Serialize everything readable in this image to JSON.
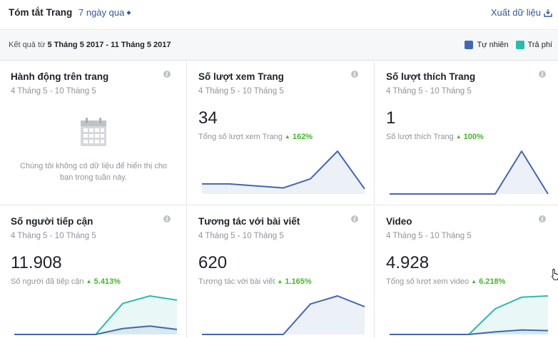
{
  "header": {
    "title": "Tóm tắt Trang",
    "range": "7 ngày qua",
    "export": "Xuất dữ liệu"
  },
  "result_bar": {
    "prefix": "Kết quả từ",
    "range": "5 Tháng 5 2017 - 11 Tháng 5 2017"
  },
  "legend": [
    {
      "label": "Tự nhiên",
      "color": "#4267b2"
    },
    {
      "label": "Trả phí",
      "color": "#2bbbad"
    }
  ],
  "colors": {
    "organic": "#4267b2",
    "paid": "#2bbbad",
    "link": "#365899",
    "up": "#42b72a"
  },
  "cards": [
    {
      "title": "Hành động trên trang",
      "date": "4 Tháng 5 - 10 Tháng 5",
      "no_data": "Chúng tôi không có dữ liệu để hiển thị cho bạn trong tuần này.",
      "icon": "calendar-icon"
    },
    {
      "title": "Số lượt xem Trang",
      "date": "4 Tháng 5 - 10 Tháng 5",
      "value": "34",
      "sub": "Tổng số lượt xem Trang",
      "change": "162%"
    },
    {
      "title": "Số lượt thích Trang",
      "date": "4 Tháng 5 - 10 Tháng 5",
      "value": "1",
      "sub": "Số lượt thích Trang",
      "change": "100%"
    },
    {
      "title": "Số người tiếp cận",
      "date": "4 Tháng 5 - 10 Tháng 5",
      "value": "11.908",
      "sub": "Số người đã tiếp cận",
      "change": "5.413%"
    },
    {
      "title": "Tương tác với bài viết",
      "date": "4 Tháng 5 - 10 Tháng 5",
      "value": "620",
      "sub": "Tương tác với bài viết",
      "change": "1.165%"
    },
    {
      "title": "Video",
      "date": "4 Tháng 5 - 10 Tháng 5",
      "value": "4.928",
      "sub": "Tổng số lượt xem video",
      "change": "6.218%"
    }
  ],
  "chart_data": [
    {
      "type": "area",
      "card": "Số lượt xem Trang",
      "series": [
        {
          "values": [
            2,
            2,
            1.6,
            1.2,
            3,
            8.5,
            1
          ]
        }
      ]
    },
    {
      "type": "area",
      "card": "Số lượt thích Trang",
      "series": [
        {
          "values": [
            0,
            0,
            0,
            0,
            0,
            1,
            0
          ]
        }
      ]
    },
    {
      "type": "area",
      "card": "Số người tiếp cận",
      "series": [
        {
          "values": [
            0,
            0,
            0,
            0,
            0.7,
            1,
            0.6
          ]
        },
        {
          "values": [
            0,
            0,
            0,
            0,
            3.7,
            4.6,
            4.1
          ]
        }
      ]
    },
    {
      "type": "area",
      "card": "Tương tác với bài viết",
      "series": [
        {
          "values": [
            0,
            0,
            0,
            0,
            3.4,
            4.3,
            3.1
          ]
        }
      ]
    },
    {
      "type": "area",
      "card": "Video",
      "series": [
        {
          "values": [
            0,
            0,
            0,
            0,
            0.4,
            0.7,
            0.6
          ]
        },
        {
          "values": [
            0,
            0,
            0,
            0,
            4,
            5.8,
            6
          ]
        }
      ]
    }
  ]
}
